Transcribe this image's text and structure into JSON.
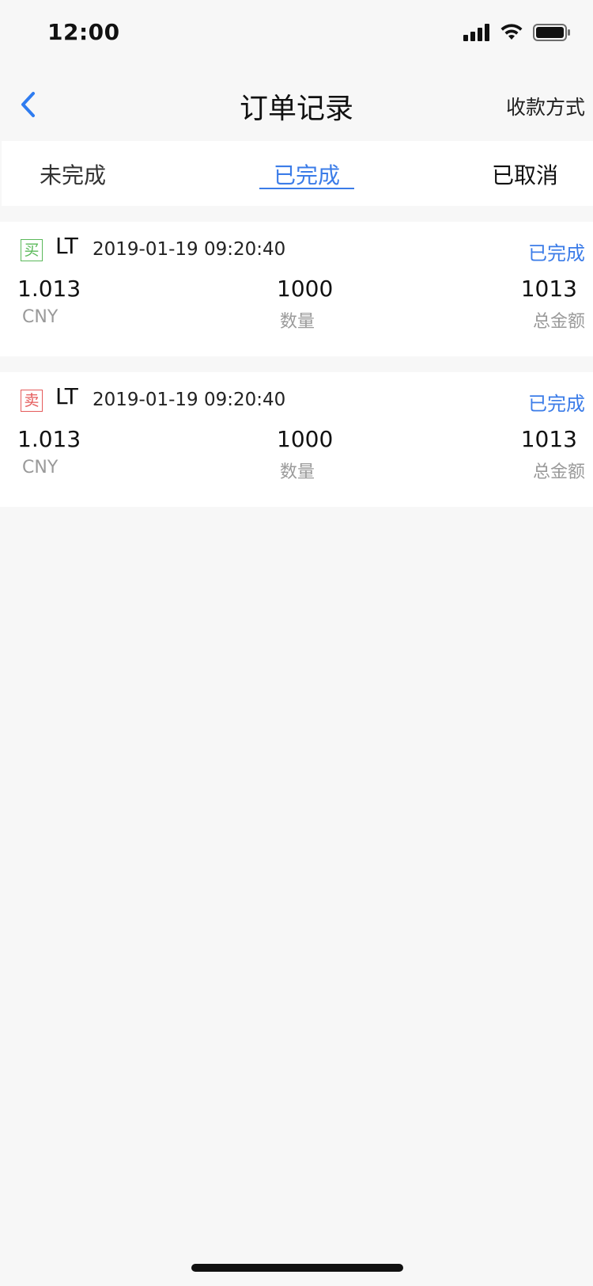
{
  "status_bar": {
    "time": "12:00",
    "icons": [
      "signal-icon",
      "wifi-icon",
      "battery-icon"
    ]
  },
  "nav": {
    "back_icon": "chevron-left-icon",
    "title": "订单记录",
    "right_action": "收款方式"
  },
  "tabs": [
    {
      "label": "未完成",
      "active": false
    },
    {
      "label": "已完成",
      "active": true
    },
    {
      "label": "已取消",
      "active": false
    }
  ],
  "orders": [
    {
      "side": "买",
      "side_type": "buy",
      "symbol": "LT",
      "time": "2019-01-19 09:20:40",
      "status": "已完成",
      "price": "1.013",
      "price_unit": "CNY",
      "quantity": "1000",
      "quantity_label": "数量",
      "total": "1013",
      "total_label": "总金额"
    },
    {
      "side": "卖",
      "side_type": "sell",
      "symbol": "LT",
      "time": "2019-01-19 09:20:40",
      "status": "已完成",
      "price": "1.013",
      "price_unit": "CNY",
      "quantity": "1000",
      "quantity_label": "数量",
      "total": "1013",
      "total_label": "总金额"
    }
  ],
  "colors": {
    "accent": "#3b7ce8",
    "buy": "#5bb95a",
    "sell": "#e55b5b",
    "background": "#f7f7f7",
    "muted_text": "#9a9a9a"
  }
}
